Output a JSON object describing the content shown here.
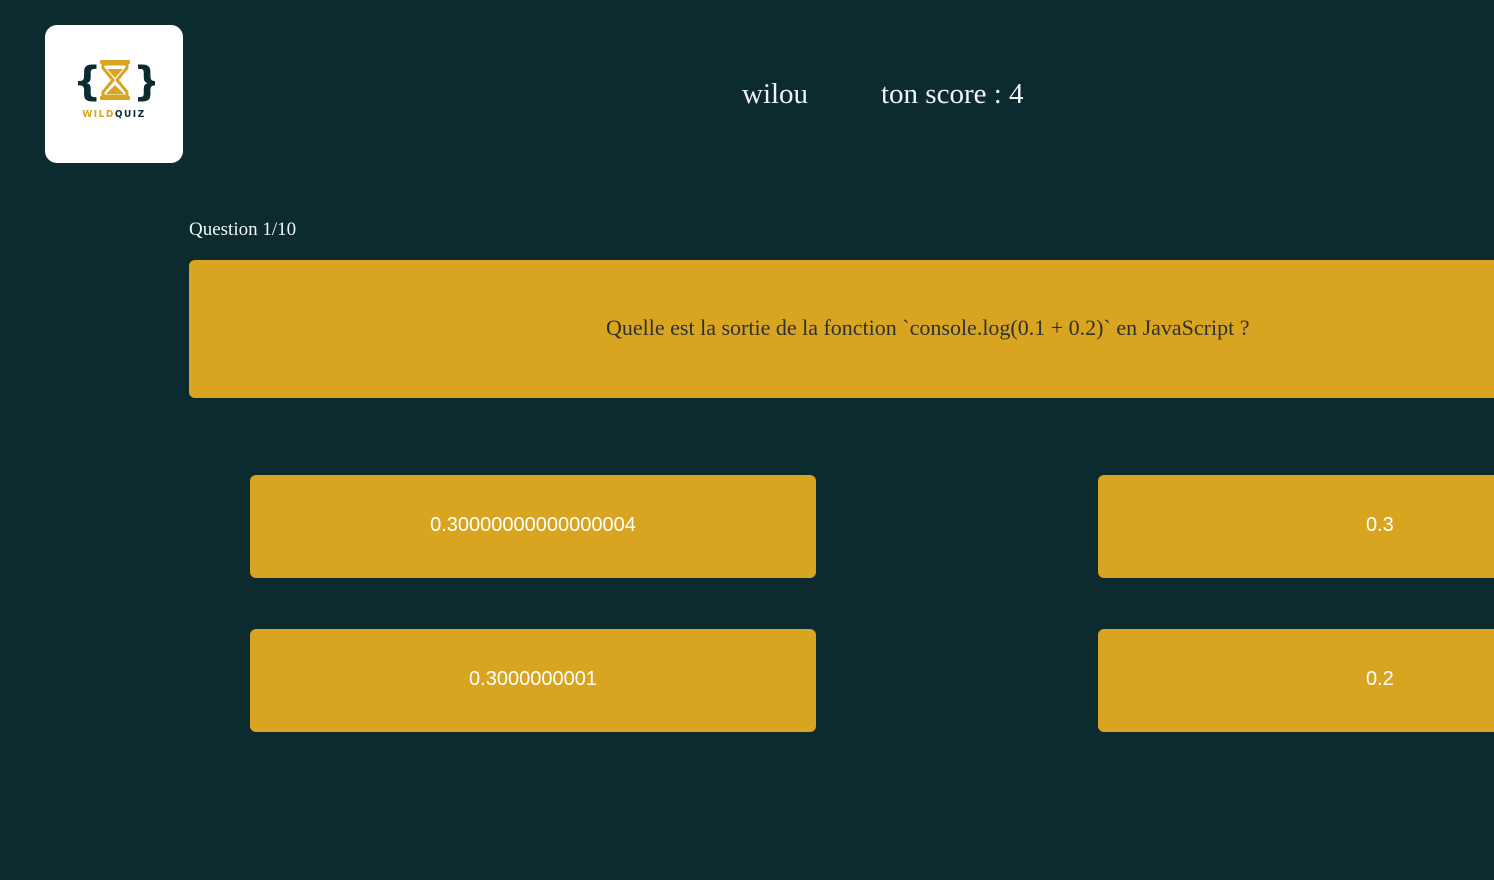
{
  "brand": {
    "logo_word_1": "WILD",
    "logo_word_2": "QUIZ",
    "accent_color": "#d9a520",
    "background_color": "#0b2b2f",
    "logo_icon": "hourglass-braces-icon"
  },
  "header": {
    "username": "wilou",
    "score_text": "ton score : 4"
  },
  "quiz": {
    "counter": "Question 1/10",
    "question": "Quelle est la sortie de la fonction `console.log(0.1 + 0.2)` en JavaScript ?",
    "answers": [
      "0.30000000000000004",
      "0.3",
      "0.3000000001",
      "0.2"
    ]
  }
}
